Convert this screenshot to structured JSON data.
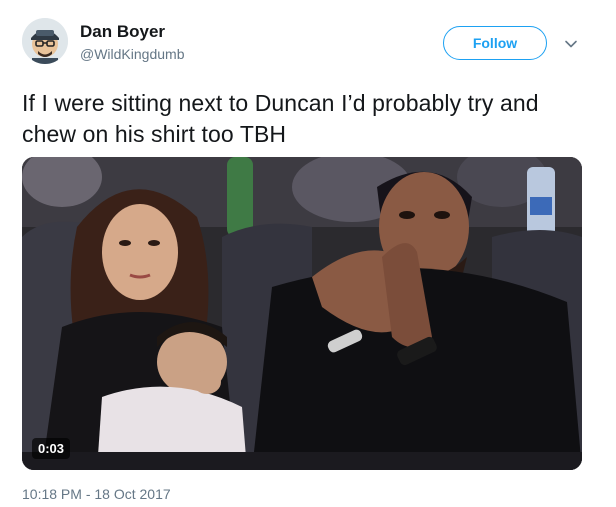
{
  "author": {
    "display_name": "Dan Boyer",
    "handle": "@WildKingdumb"
  },
  "follow_button": {
    "label": "Follow"
  },
  "tweet": {
    "text": "If I were sitting next to Duncan I’d probably try and chew on his shirt too TBH"
  },
  "media": {
    "duration": "0:03"
  },
  "meta": {
    "timestamp": "10:18 PM - 18 Oct 2017"
  },
  "icons": {
    "menu": "chevron-down-icon",
    "avatar": "avatar"
  },
  "colors": {
    "accent": "#1da1f2",
    "secondary_text": "#657786",
    "primary_text": "#14171a"
  }
}
